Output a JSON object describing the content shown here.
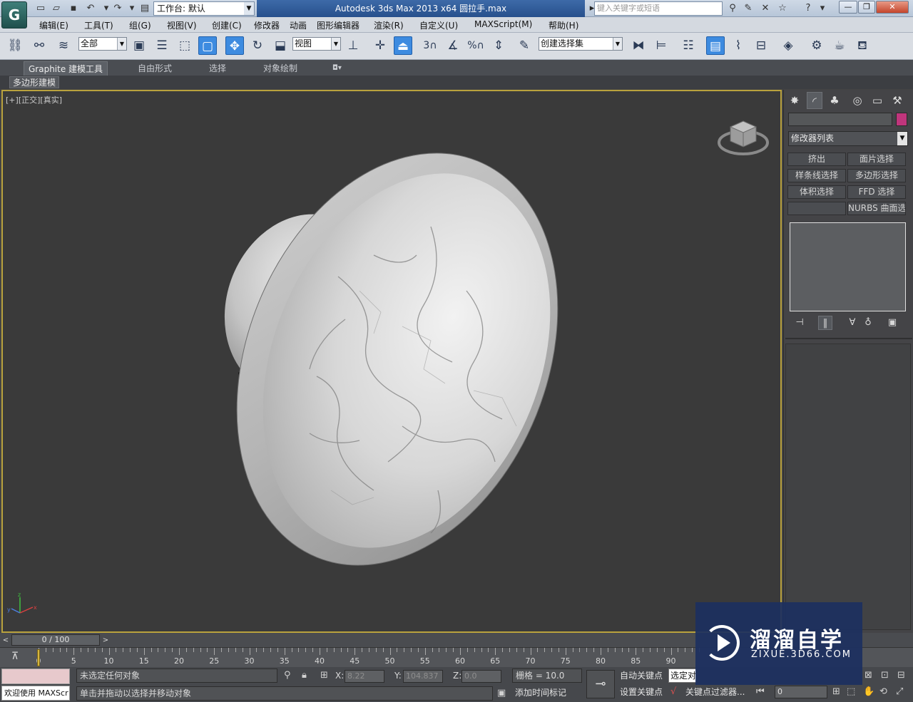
{
  "titlebar": {
    "workspace_label": "工作台: 默认",
    "title": "Autodesk 3ds Max  2013 x64      圆拉手.max",
    "search_placeholder": "键入关键字或短语"
  },
  "menu": [
    "编辑(E)",
    "工具(T)",
    "组(G)",
    "视图(V)",
    "创建(C)",
    "修改器",
    "动画",
    "图形编辑器",
    "渲染(R)",
    "自定义(U)",
    "MAXScript(M)",
    "帮助(H)"
  ],
  "toolbar": {
    "selection_filter": "全部",
    "ref_coord": "视图",
    "named_selection": "创建选择集",
    "snap_3": "3",
    "snap_percent": "%"
  },
  "ribbon": {
    "tabs": [
      "Graphite 建模工具",
      "自由形式",
      "选择",
      "对象绘制"
    ],
    "sub_item": "多边形建模"
  },
  "viewport": {
    "label_plus": "[+]",
    "label_view": "[正交]",
    "label_shading": "[真实]"
  },
  "command_panel": {
    "modifier_list": "修改器列表",
    "buttons": [
      "挤出",
      "面片选择",
      "样条线选择",
      "多边形选择",
      "体积选择",
      "FFD 选择",
      "",
      "NURBS 曲面选择"
    ],
    "color_swatch": "#c0357c"
  },
  "time_slider": {
    "frame": "0 / 100",
    "prev": "<",
    "next": ">"
  },
  "trackbar": {
    "ticks": [
      "0",
      "5",
      "10",
      "15",
      "20",
      "25",
      "30",
      "35",
      "40",
      "45",
      "50",
      "55",
      "60",
      "65",
      "70",
      "75",
      "80",
      "85",
      "90"
    ]
  },
  "status": {
    "welcome": "欢迎使用 MAXScr",
    "selection_status": "未选定任何对象",
    "prompt": "单击并拖动以选择并移动对象",
    "x_label": "X:",
    "x_value": "8.22",
    "y_label": "Y:",
    "y_value": "104.837",
    "z_label": "Z:",
    "z_value": "0.0",
    "grid": "栅格 = 10.0",
    "add_time_tag": "添加时间标记",
    "auto_key": "自动关键点",
    "set_key": "设置关键点",
    "selected_dropdown": "选定对",
    "key_filters": "关键点过滤器...",
    "frame_field": "0"
  },
  "watermark": {
    "title": "溜溜自学",
    "url": "ZIXUE.3D66.COM"
  },
  "colors": {
    "viewport_border": "#b9a23d",
    "active_tool": "#3d8be0",
    "title_bar": "#27508c"
  }
}
